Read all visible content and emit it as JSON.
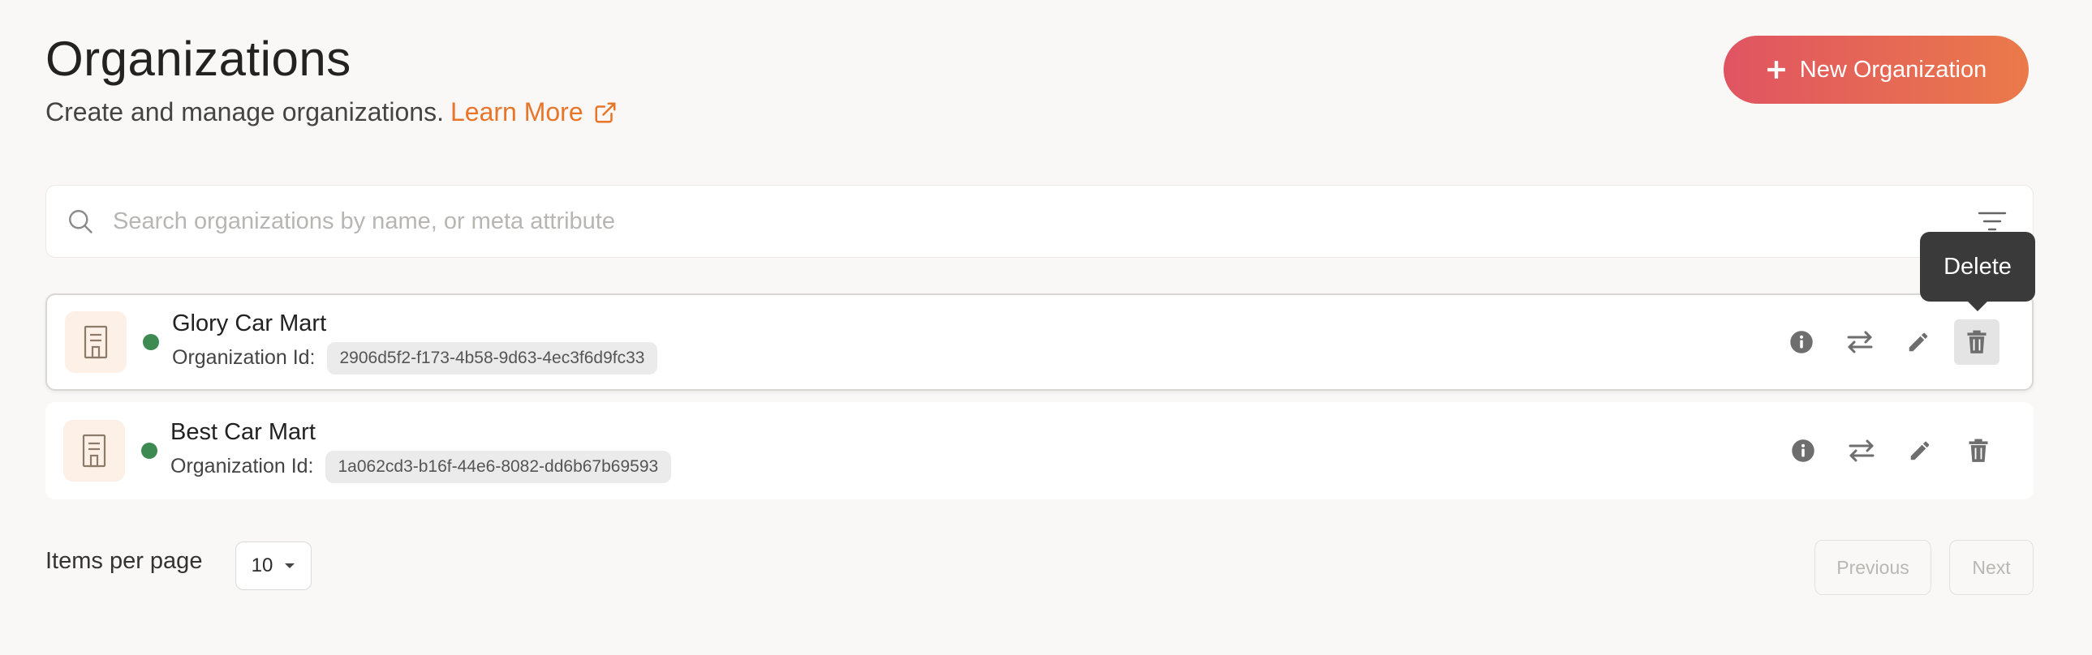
{
  "header": {
    "title": "Organizations",
    "subtitle": "Create and manage organizations.",
    "learn_more": "Learn More",
    "new_button": "New Organization"
  },
  "search": {
    "placeholder": "Search organizations by name, or meta attribute",
    "value": ""
  },
  "organizations": [
    {
      "name": "Glory Car Mart",
      "id_label": "Organization Id:",
      "id": "2906d5f2-f173-4b58-9d63-4ec3f6d9fc33",
      "status_color": "#3d8a52"
    },
    {
      "name": "Best Car Mart",
      "id_label": "Organization Id:",
      "id": "1a062cd3-b16f-44e6-8082-dd6b67b69593",
      "status_color": "#3d8a52"
    }
  ],
  "row_actions": [
    "info-icon",
    "switch-icon",
    "edit-icon",
    "delete-icon"
  ],
  "tooltip": {
    "text": "Delete"
  },
  "pagination": {
    "items_per_page_label": "Items per page",
    "page_size": "10",
    "previous": "Previous",
    "next": "Next"
  },
  "colors": {
    "accent": "#e8752a",
    "gradient_start": "#e05462",
    "gradient_end": "#ea7a4a",
    "status_active": "#3d8a52"
  }
}
